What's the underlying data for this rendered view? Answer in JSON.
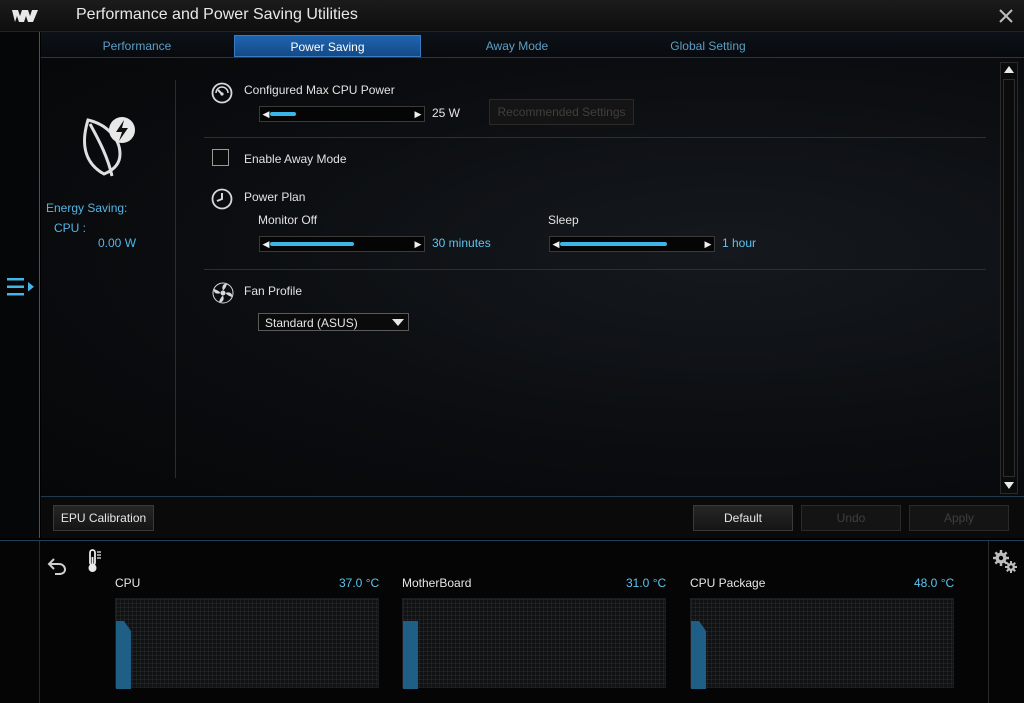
{
  "window": {
    "title": "Performance and Power Saving Utilities"
  },
  "tabs": [
    {
      "label": "Performance",
      "active": false
    },
    {
      "label": "Power Saving",
      "active": true
    },
    {
      "label": "Away Mode",
      "active": false
    },
    {
      "label": "Global Setting",
      "active": false
    }
  ],
  "summary": {
    "energy_label": "Energy Saving:",
    "cpu_label": "CPU :",
    "cpu_value": "0.00 W"
  },
  "max_cpu_power": {
    "label": "Configured Max CPU Power",
    "value": "25 W",
    "slider_fraction": 0.18,
    "recommended_label": "Recommended Settings"
  },
  "away_mode": {
    "label": "Enable Away Mode",
    "checked": false
  },
  "power_plan": {
    "label": "Power Plan",
    "monitor_off": {
      "label": "Monitor Off",
      "value": "30 minutes",
      "slider_fraction": 0.59
    },
    "sleep": {
      "label": "Sleep",
      "value": "1 hour",
      "slider_fraction": 0.75
    }
  },
  "fan_profile": {
    "label": "Fan Profile",
    "selected": "Standard (ASUS)"
  },
  "buttons": {
    "epu_calibration": "EPU Calibration",
    "default": "Default",
    "undo": "Undo",
    "apply": "Apply"
  },
  "monitors": [
    {
      "label": "CPU",
      "value": "37.0 °C"
    },
    {
      "label": "MotherBoard",
      "value": "31.0 °C"
    },
    {
      "label": "CPU Package",
      "value": "48.0 °C"
    }
  ],
  "colors": {
    "accent": "#3ab6e8",
    "tab_active": "#1f64b0",
    "info_text": "#55b5e6"
  },
  "icons": [
    "tuf-logo-icon",
    "close-icon",
    "menu-toggle-icon",
    "leaf-bolt-icon",
    "speedometer-icon",
    "clock-icon",
    "fan-icon",
    "back-arrow-icon",
    "thermometer-icon",
    "gear-icon"
  ]
}
